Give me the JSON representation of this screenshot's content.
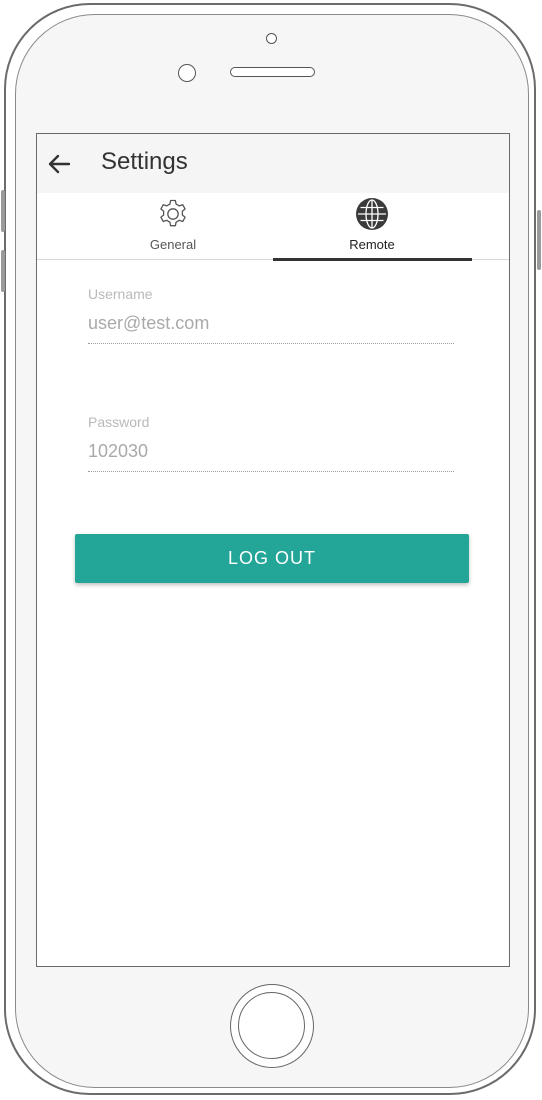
{
  "appbar": {
    "title": "Settings",
    "back_icon": "arrow-left-icon"
  },
  "tabs": [
    {
      "label": "General",
      "icon": "gear-icon",
      "active": false
    },
    {
      "label": "Remote",
      "icon": "globe-icon",
      "active": true
    }
  ],
  "form": {
    "username": {
      "label": "Username",
      "value": "user@test.com"
    },
    "password": {
      "label": "Password",
      "value": "102030"
    }
  },
  "actions": {
    "logout_label": "LOG OUT"
  },
  "colors": {
    "accent": "#23a598",
    "appbar_bg": "#f5f5f5",
    "active_tab_indicator": "#333333"
  }
}
